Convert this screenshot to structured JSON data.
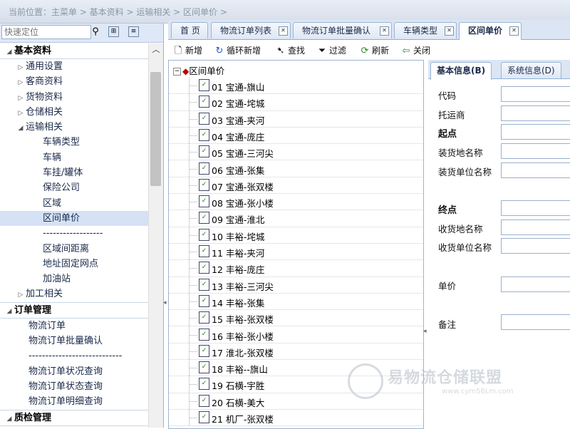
{
  "breadcrumb": "当前位置：主菜单 > 基本资料 > 运输相关 > 区间单价 >",
  "sidebar": {
    "search_placeholder": "快速定位",
    "groups": [
      {
        "label": "基本资料",
        "items": [
          "通用设置",
          "客商资料",
          "货物资料",
          "仓储相关",
          "运输相关"
        ]
      },
      {
        "sub_items": [
          "车辆类型",
          "车辆",
          "车挂/罐体",
          "保险公司",
          "区域",
          "区间单价",
          "------------------",
          "区域间距离",
          "地址固定网点",
          "加油站"
        ]
      },
      {
        "label": "加工相关"
      },
      {
        "label": "订单管理",
        "items": [
          "物流订单",
          "物流订单批量确认",
          "----------------------------",
          "物流订单状况查询",
          "物流订单状态查询",
          "物流订单明细查询"
        ]
      },
      {
        "label": "质检管理"
      }
    ]
  },
  "tabs": [
    "首 页",
    "物流订单列表",
    "物流订单批量确认",
    "车辆类型",
    "区间单价"
  ],
  "toolbar": [
    "新增",
    "循环新增",
    "查找",
    "过滤",
    "刷新",
    "关闭"
  ],
  "tree": {
    "root": "区间单价",
    "items": [
      "01 宝通-旗山",
      "02 宝通-垞城",
      "03 宝通-夹河",
      "04 宝通-庞庄",
      "05 宝通-三河尖",
      "06 宝通-张集",
      "07 宝通-张双楼",
      "08 宝通-张小楼",
      "09 宝通-淮北",
      "10 丰裕-垞城",
      "11 丰裕-夹河",
      "12 丰裕-庞庄",
      "13 丰裕-三河尖",
      "14 丰裕-张集",
      "15 丰裕-张双楼",
      "16 丰裕-张小楼",
      "17 淮北-张双楼",
      "18 丰裕--旗山",
      "19 石横-宇胜",
      "20 石横-美大",
      "21 机厂-张双楼"
    ]
  },
  "form": {
    "tabs": [
      "基本信息(B)",
      "系统信息(D)"
    ],
    "code": "代码",
    "shipper": "托运商",
    "start": "起点",
    "load_place": "装货地名称",
    "load_unit": "装货单位名称",
    "end": "终点",
    "recv_place": "收货地名称",
    "recv_unit": "收货单位名称",
    "price": "单价",
    "remark": "备注"
  },
  "watermark": {
    "text": "易物流仓储联盟",
    "url": "www.cym56Lm.com"
  }
}
